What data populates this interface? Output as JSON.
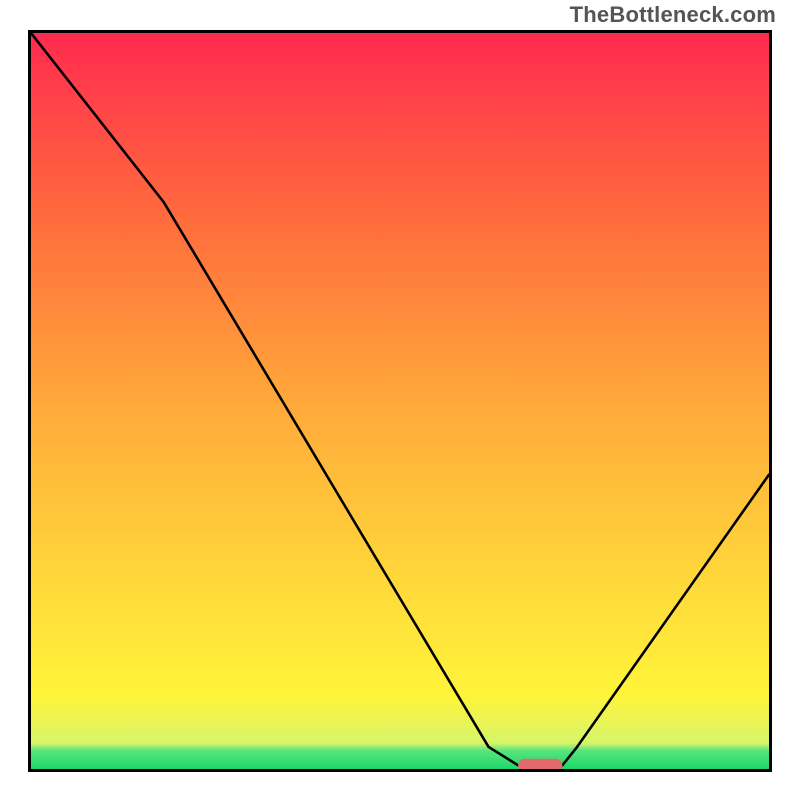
{
  "watermark": "TheBottleneck.com",
  "chart_data": {
    "type": "line",
    "title": "",
    "xlabel": "",
    "ylabel": "",
    "x_range": [
      0,
      100
    ],
    "y_range": [
      0,
      100
    ],
    "series": [
      {
        "name": "bottleneck-curve",
        "x": [
          0,
          18,
          62,
          66,
          72,
          74,
          100
        ],
        "y": [
          100,
          77,
          3,
          0.5,
          0.5,
          3,
          40
        ]
      }
    ],
    "marker": {
      "name": "optimal-marker",
      "x_start": 66,
      "x_end": 72,
      "y": 0.5,
      "color": "#e26a6d"
    },
    "gradient_colors": {
      "top": "#ff2a4f",
      "mid_upper": "#ff6b3d",
      "mid": "#ffa83a",
      "mid_lower": "#ffd93a",
      "yellow": "#fff43a",
      "green_light": "#d7f56b",
      "green": "#57e67c",
      "green_dark": "#1fd66a"
    }
  }
}
